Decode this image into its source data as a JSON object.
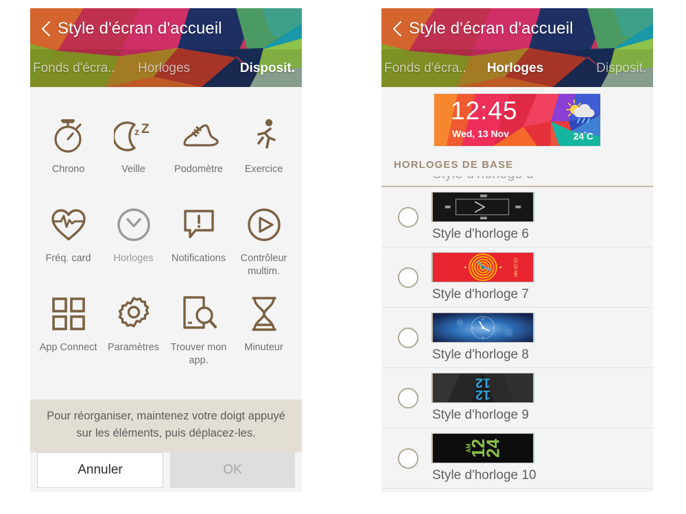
{
  "header": {
    "title": "Style d'écran d'accueil",
    "back_icon": "chevron-left-icon",
    "tabs": [
      {
        "label": "Fonds d'écra..",
        "active_left": false,
        "active_right": false
      },
      {
        "label": "Horloges",
        "active_left": false,
        "active_right": true
      },
      {
        "label": "Disposit.",
        "active_left": true,
        "active_right": false
      }
    ]
  },
  "left_panel": {
    "apps": [
      {
        "label": "Chrono",
        "icon": "stopwatch-icon",
        "disabled": false
      },
      {
        "label": "Veille",
        "icon": "moon-sleep-icon",
        "disabled": false
      },
      {
        "label": "Podomètre",
        "icon": "shoe-icon",
        "disabled": false
      },
      {
        "label": "Exercice",
        "icon": "running-person-icon",
        "disabled": false
      },
      {
        "label": "Fréq. card",
        "icon": "heart-rate-icon",
        "disabled": false
      },
      {
        "label": "Horloges",
        "icon": "clock-icon",
        "disabled": true
      },
      {
        "label": "Notifications",
        "icon": "notification-bubble-icon",
        "disabled": false
      },
      {
        "label": "Contrôleur multim.",
        "icon": "media-play-icon",
        "disabled": false
      },
      {
        "label": "App Connect",
        "icon": "app-grid-icon",
        "disabled": false
      },
      {
        "label": "Paramètres",
        "icon": "gear-icon",
        "disabled": false
      },
      {
        "label": "Trouver mon app.",
        "icon": "find-my-phone-icon",
        "disabled": false
      },
      {
        "label": "Minuteur",
        "icon": "hourglass-icon",
        "disabled": false
      }
    ],
    "note": "Pour réorganiser, maintenez votre doigt appuyé sur les éléments, puis déplacez-les.",
    "buttons": {
      "cancel": "Annuler",
      "ok": "OK"
    }
  },
  "right_panel": {
    "widget_preview": {
      "time": "12:45",
      "date": "Wed, 13 Nov",
      "temperature": "24",
      "degree": "°",
      "unit": "C",
      "weather_icon": "sun-cloud-rain-icon"
    },
    "section_title": "HORLOGES DE BASE",
    "clock_styles": [
      {
        "label": "Style d'horloge 6",
        "selected": false,
        "thumb": "minimal-dark-clock-thumb"
      },
      {
        "label": "Style d'horloge 7",
        "selected": false,
        "thumb": "red-rings-clock-thumb"
      },
      {
        "label": "Style d'horloge 8",
        "selected": false,
        "thumb": "blue-analog-clock-thumb"
      },
      {
        "label": "Style d'horloge 9",
        "selected": false,
        "thumb": "dark-blue-digits-thumb"
      },
      {
        "label": "Style d'horloge 10",
        "selected": false,
        "thumb": "black-green-digits-thumb"
      }
    ]
  },
  "colors": {
    "panel_bg": "#f4f4f4",
    "icon_brown": "#7b6143",
    "icon_disabled": "#9a9a9a",
    "note_bg": "#e3ded4",
    "section_text": "#9b8a74",
    "ok_disabled_bg": "#dedede"
  }
}
